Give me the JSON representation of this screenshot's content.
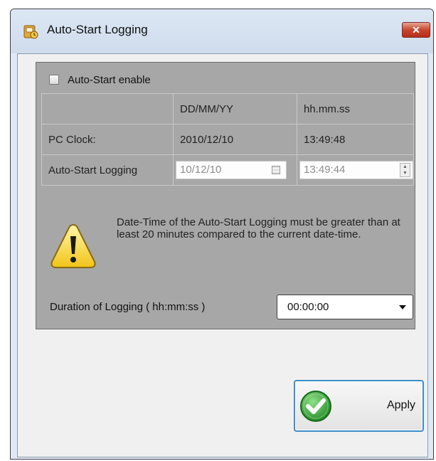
{
  "window": {
    "title": "Auto-Start Logging",
    "close_icon": "close-icon",
    "app_icon": "logger-app-icon"
  },
  "autostart": {
    "enable_label": "Auto-Start enable",
    "enabled": false
  },
  "grid": {
    "headers": [
      "",
      "DD/MM/YY",
      "hh.mm.ss"
    ],
    "pc_clock": {
      "label": "PC Clock:",
      "date": "2010/12/10",
      "time": "13:49:48"
    },
    "auto_start": {
      "label": "Auto-Start Logging",
      "date": "10/12/10",
      "time": "13:49:44"
    }
  },
  "warning": {
    "icon": "warning-icon",
    "text": "Date-Time of the Auto-Start Logging must be greater than at least 20 minutes compared to the current date-time."
  },
  "duration": {
    "label": "Duration of Logging  ( hh:mm:ss )",
    "value": "00:00:00"
  },
  "apply": {
    "label": "Apply",
    "icon": "checkmark-icon"
  },
  "colors": {
    "panel_bg": "#a7a7a7",
    "accent": "#3b8ec8",
    "close_red": "#c9462e",
    "check_green": "#2fa02f"
  }
}
